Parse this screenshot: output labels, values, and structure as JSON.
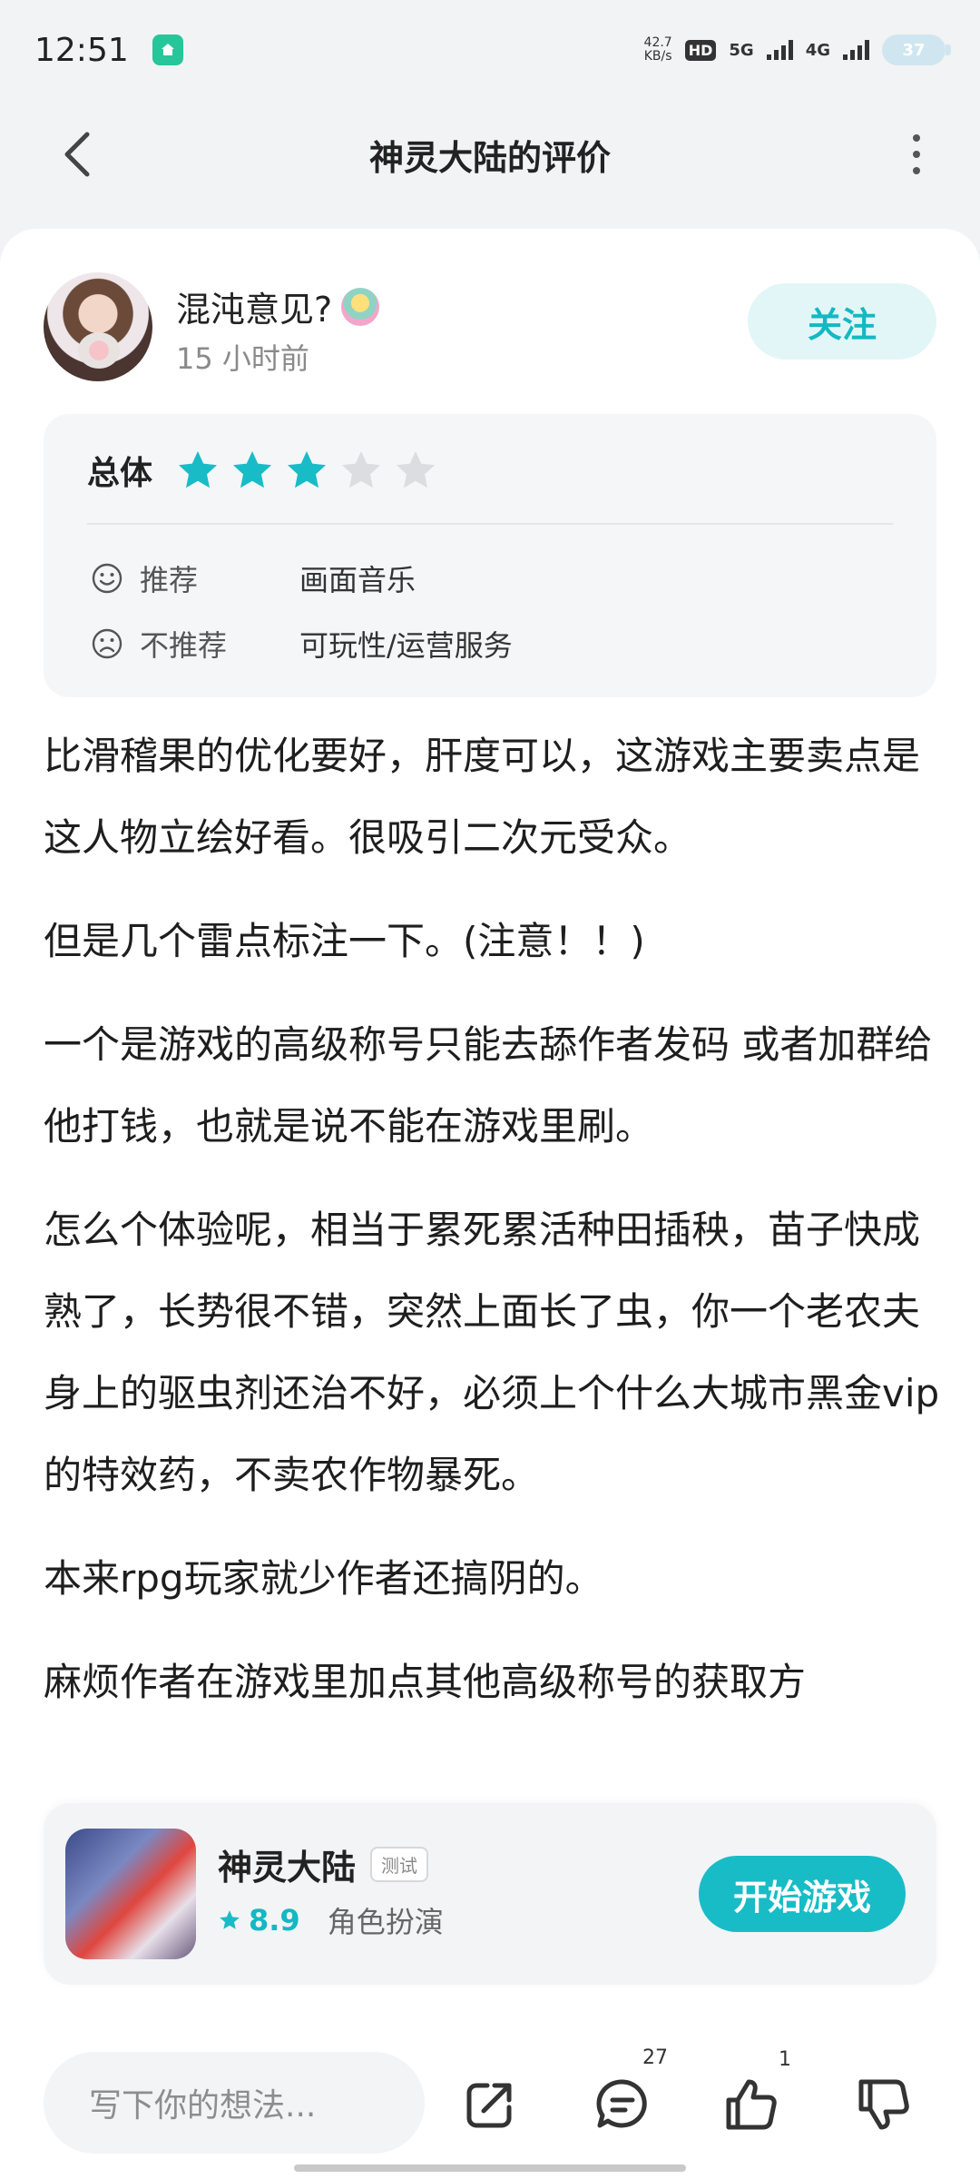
{
  "status_bar": {
    "time": "12:51",
    "net_speed_value": "42.7",
    "net_speed_unit": "KB/s",
    "hd_label": "HD",
    "sim1": "5G",
    "sim2": "4G",
    "battery": "37"
  },
  "header": {
    "title": "神灵大陆的评价"
  },
  "author": {
    "name": "混沌意见?",
    "time": "15 小时前",
    "follow_label": "关注"
  },
  "rating": {
    "overall_label": "总体",
    "stars_filled": 3,
    "stars_total": 5,
    "recommend_label": "推荐",
    "recommend_value": "画面音乐",
    "not_recommend_label": "不推荐",
    "not_recommend_value": "可玩性/运营服务"
  },
  "review": {
    "paragraphs": [
      "比滑稽果的优化要好，肝度可以，这游戏主要卖点是这人物立绘好看。很吸引二次元受众。",
      "但是几个雷点标注一下。(注意！！)",
      "一个是游戏的高级称号只能去舔作者发码 或者加群给他打钱，也就是说不能在游戏里刷。",
      "怎么个体验呢，相当于累死累活种田插秧，苗子快成熟了，长势很不错，突然上面长了虫，你一个老农夫身上的驱虫剂还治不好，必须上个什么大城市黑金vip的特效药，不卖农作物暴死。",
      "本来rpg玩家就少作者还搞阴的。",
      "麻烦作者在游戏里加点其他高级称号的获取方"
    ]
  },
  "game": {
    "name": "神灵大陆",
    "tag": "测试",
    "score": "8.9",
    "genre": "角色扮演",
    "start_label": "开始游戏"
  },
  "toolbar": {
    "comment_placeholder": "写下你的想法...",
    "comment_count": "27",
    "like_count": "1"
  },
  "colors": {
    "accent": "#18bcc6",
    "star_empty": "#dcdde0"
  }
}
